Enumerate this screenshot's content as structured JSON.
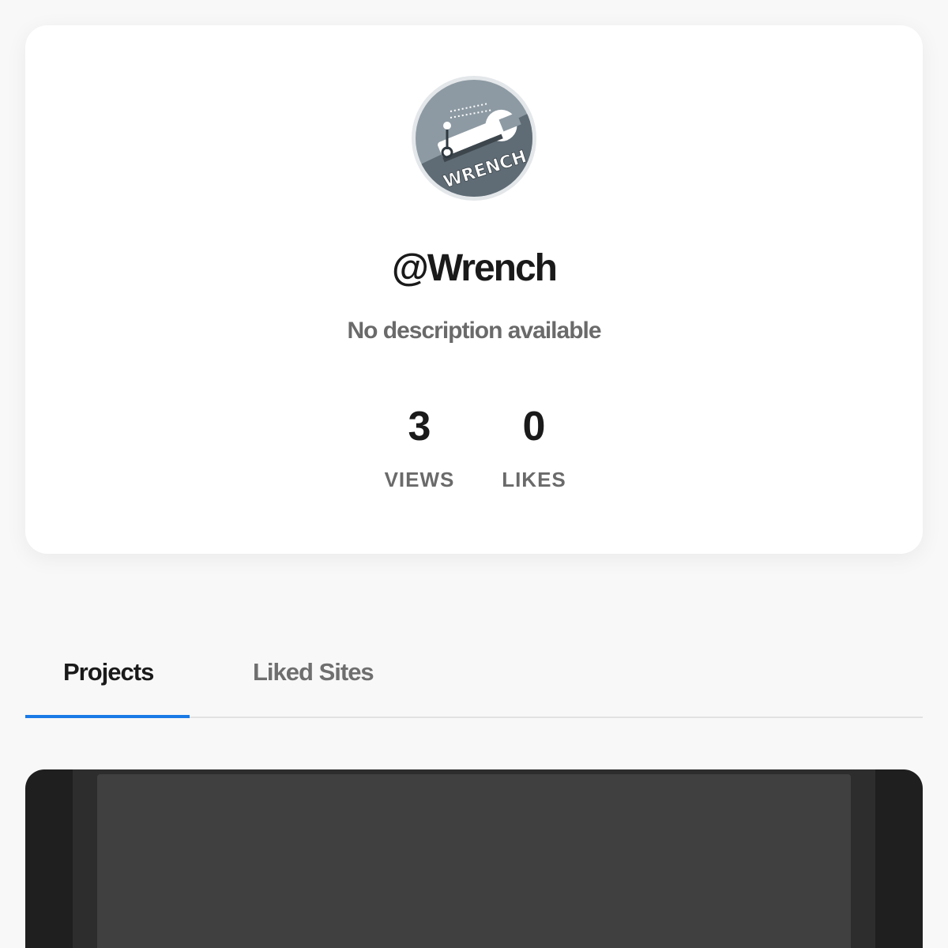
{
  "profile": {
    "avatar_icon": "wrench-logo-icon",
    "avatar_text": "WRENCH",
    "username": "@Wrench",
    "description": "No description available",
    "stats": [
      {
        "value": "3",
        "label": "VIEWS"
      },
      {
        "value": "0",
        "label": "LIKES"
      }
    ]
  },
  "tabs": {
    "items": [
      {
        "label": "Projects",
        "active": true
      },
      {
        "label": "Liked Sites",
        "active": false
      }
    ],
    "active_color": "#1a7ae6"
  },
  "projects": {
    "items": [
      {
        "thumbnail": "dark-preview"
      }
    ]
  }
}
